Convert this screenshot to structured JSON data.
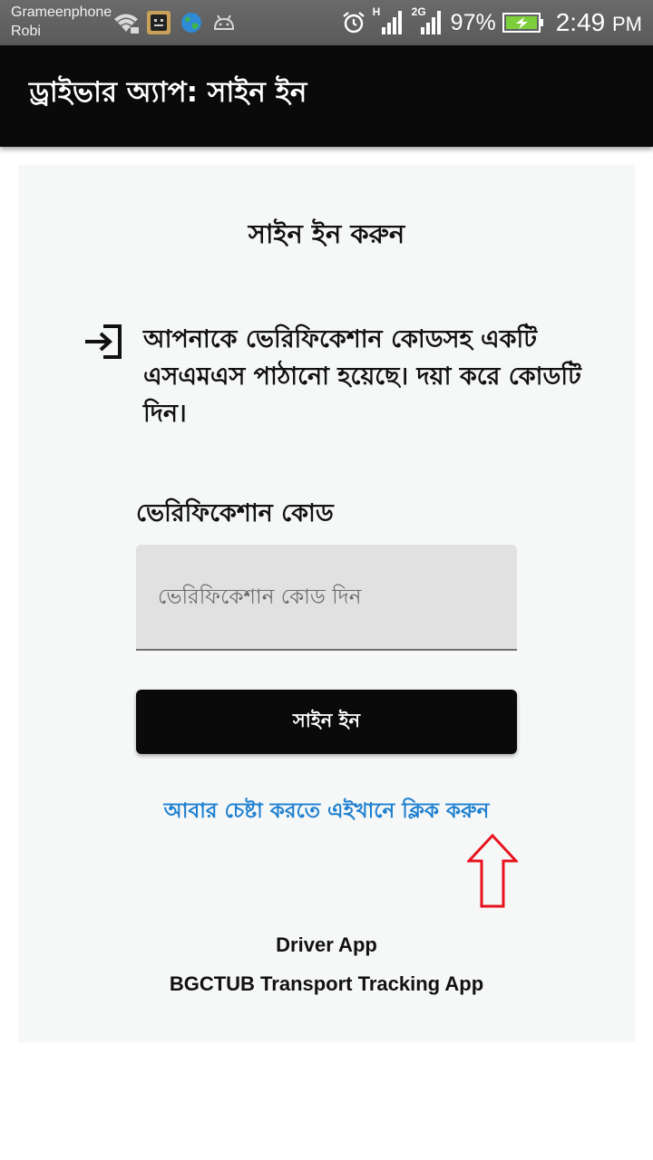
{
  "status_bar": {
    "carrier_1": "Grameenphone",
    "carrier_2": "Robi",
    "network_1": "H",
    "network_2": "2G",
    "battery": "97%",
    "time": "2:49",
    "time_suffix": "PM",
    "icons": [
      "wifi-icon",
      "app-notification-icon",
      "globe-icon",
      "android-icon",
      "alarm-icon",
      "signal-icon",
      "signal-icon",
      "battery-charging-icon"
    ]
  },
  "app_bar": {
    "title": "ড্রাইভার অ্যাপ: সাইন ইন"
  },
  "card": {
    "title": "সাইন ইন করুন",
    "icon": "sign-in-arrow-icon",
    "message": "আপনাকে ভেরিফিকেশান কোডসহ একটি এসএমএস পাঠানো হয়েছে। দয়া করে কোডটি দিন।",
    "field_label": "ভেরিফিকেশান কোড",
    "code_input": {
      "value": "",
      "placeholder": "ভেরিফিকেশান কোড দিন"
    },
    "sign_in_button": "সাইন ইন",
    "retry_link": "আবার চেষ্টা করতে এইখানে ক্লিক করুন",
    "footer_line_1": "Driver App",
    "footer_line_2": "BGCTUB Transport Tracking App"
  },
  "annotation": {
    "arrow_color": "#e8121d"
  },
  "colors": {
    "status_bar": "#5f5f5f",
    "app_bar": "#0a0a0a",
    "card_bg": "#f5f8f7",
    "input_bg": "#e1e1e1",
    "button": "#0a0a0a",
    "link": "#1e7fd0"
  }
}
